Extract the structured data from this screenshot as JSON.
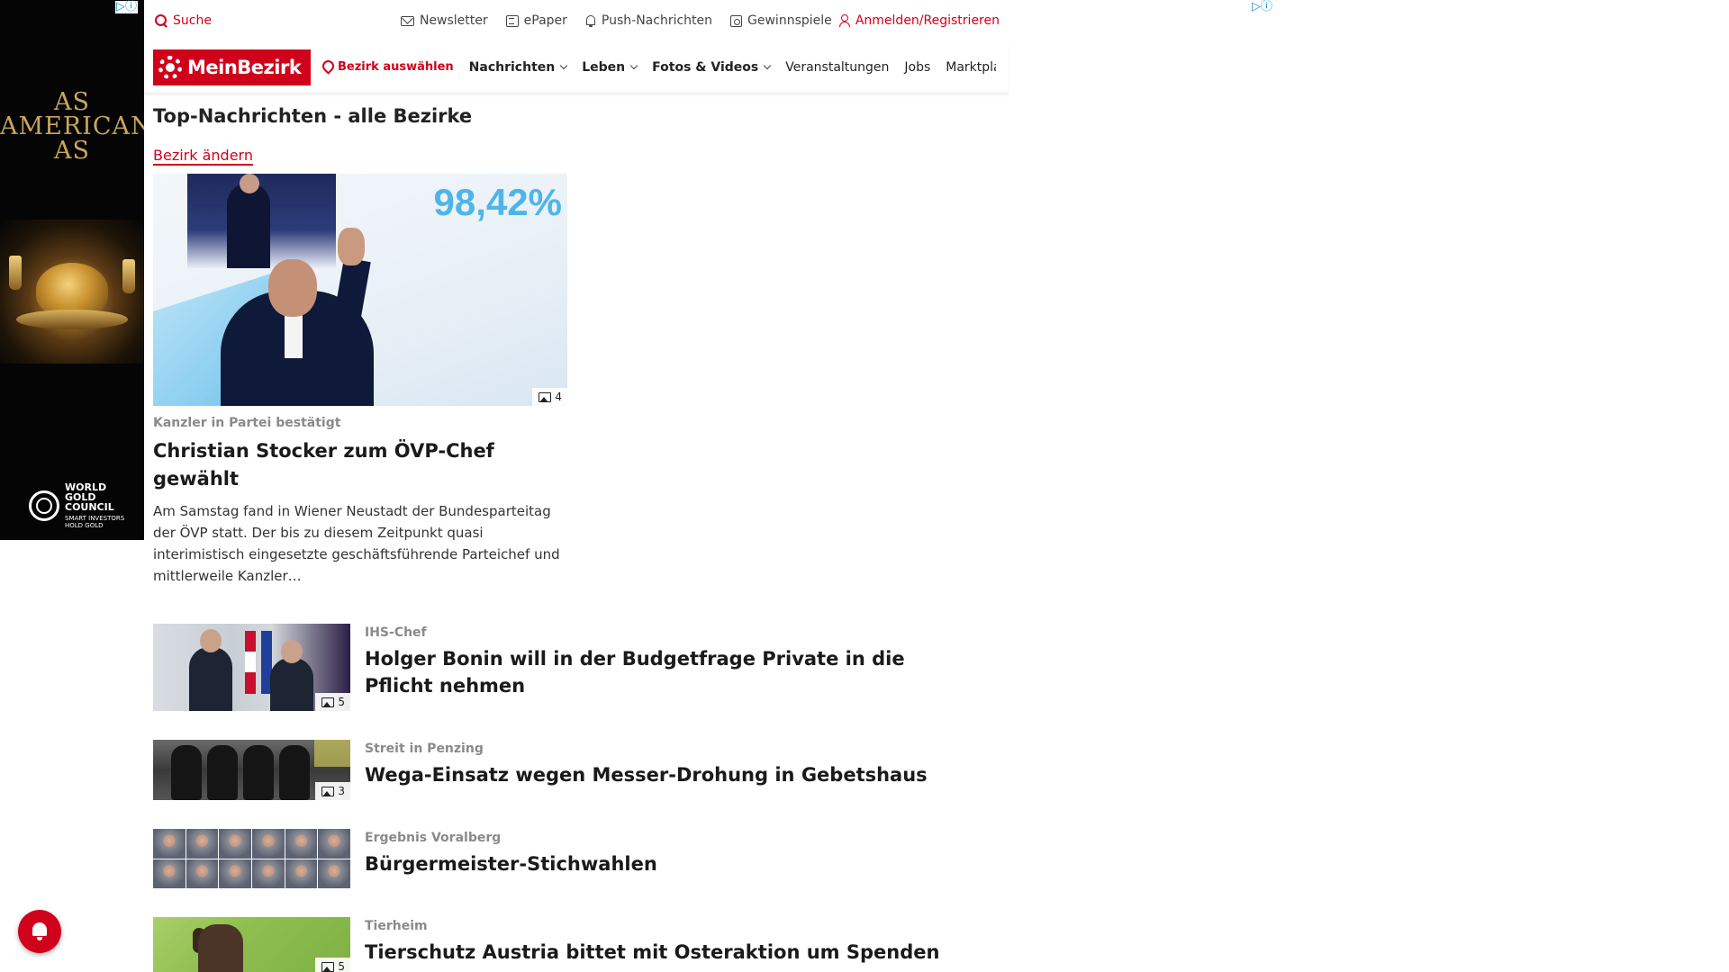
{
  "ad_left": {
    "headline": [
      "AS",
      "AMERICAN",
      "AS"
    ],
    "brand_lines": [
      "WORLD",
      "GOLD",
      "COUNCIL"
    ],
    "brand_sub": [
      "SMART INVESTORS",
      "HOLD GOLD"
    ],
    "adchoice_glyph": "▷ⓘ"
  },
  "ad_right": {
    "adchoice_glyph": "▷ⓘ"
  },
  "topbar": {
    "search_label": "Suche",
    "newsletter_label": "Newsletter",
    "epaper_label": "ePaper",
    "push_label": "Push-Nachrichten",
    "gewinnspiele_label": "Gewinnspiele",
    "login_label": "Anmelden/Registrieren"
  },
  "nav": {
    "logo_text": "MeinBezirk",
    "bezirk_select": "Bezirk auswählen",
    "items": [
      "Nachrichten",
      "Leben",
      "Fotos & Videos",
      "Veranstaltungen",
      "Jobs",
      "Marktplatz"
    ]
  },
  "page": {
    "title": "Top-Nachrichten - alle Bezirke",
    "change_link": "Bezirk ändern"
  },
  "hero": {
    "image_text": "98,42%",
    "photo_count": "4",
    "kicker": "Kanzler in Partei bestätigt",
    "title": "Christian Stocker zum ÖVP-Chef gewählt",
    "teaser": "Am Samstag fand in Wiener Neustadt der Bundesparteitag der ÖVP statt. Der bis zu diesem Zeitpunkt quasi interimistisch eingesetzte geschäftsführende Parteichef und mittlerweile Kanzler…"
  },
  "articles": [
    {
      "kicker": "IHS-Chef",
      "title": "Holger Bonin will in der Budgetfrage Private in die Pflicht nehmen",
      "photo_count": "5"
    },
    {
      "kicker": "Streit in Penzing",
      "title": "Wega-Einsatz wegen Messer-Drohung in Gebetshaus",
      "photo_count": "3"
    },
    {
      "kicker": "Ergebnis Voralberg",
      "title": "Bürgermeister-Stichwahlen",
      "photo_count": ""
    },
    {
      "kicker": "Tierheim",
      "title": "Tierschutz Austria bittet mit Osteraktion um Spenden",
      "photo_count": "5"
    }
  ],
  "colors": {
    "brand_red": "#d0021b",
    "kicker_gray": "#8a8a8a"
  },
  "icons": [
    "search-icon",
    "mail-icon",
    "epaper-icon",
    "bell-icon",
    "gift-icon",
    "user-icon",
    "location-pin-icon",
    "gallery-icon"
  ]
}
